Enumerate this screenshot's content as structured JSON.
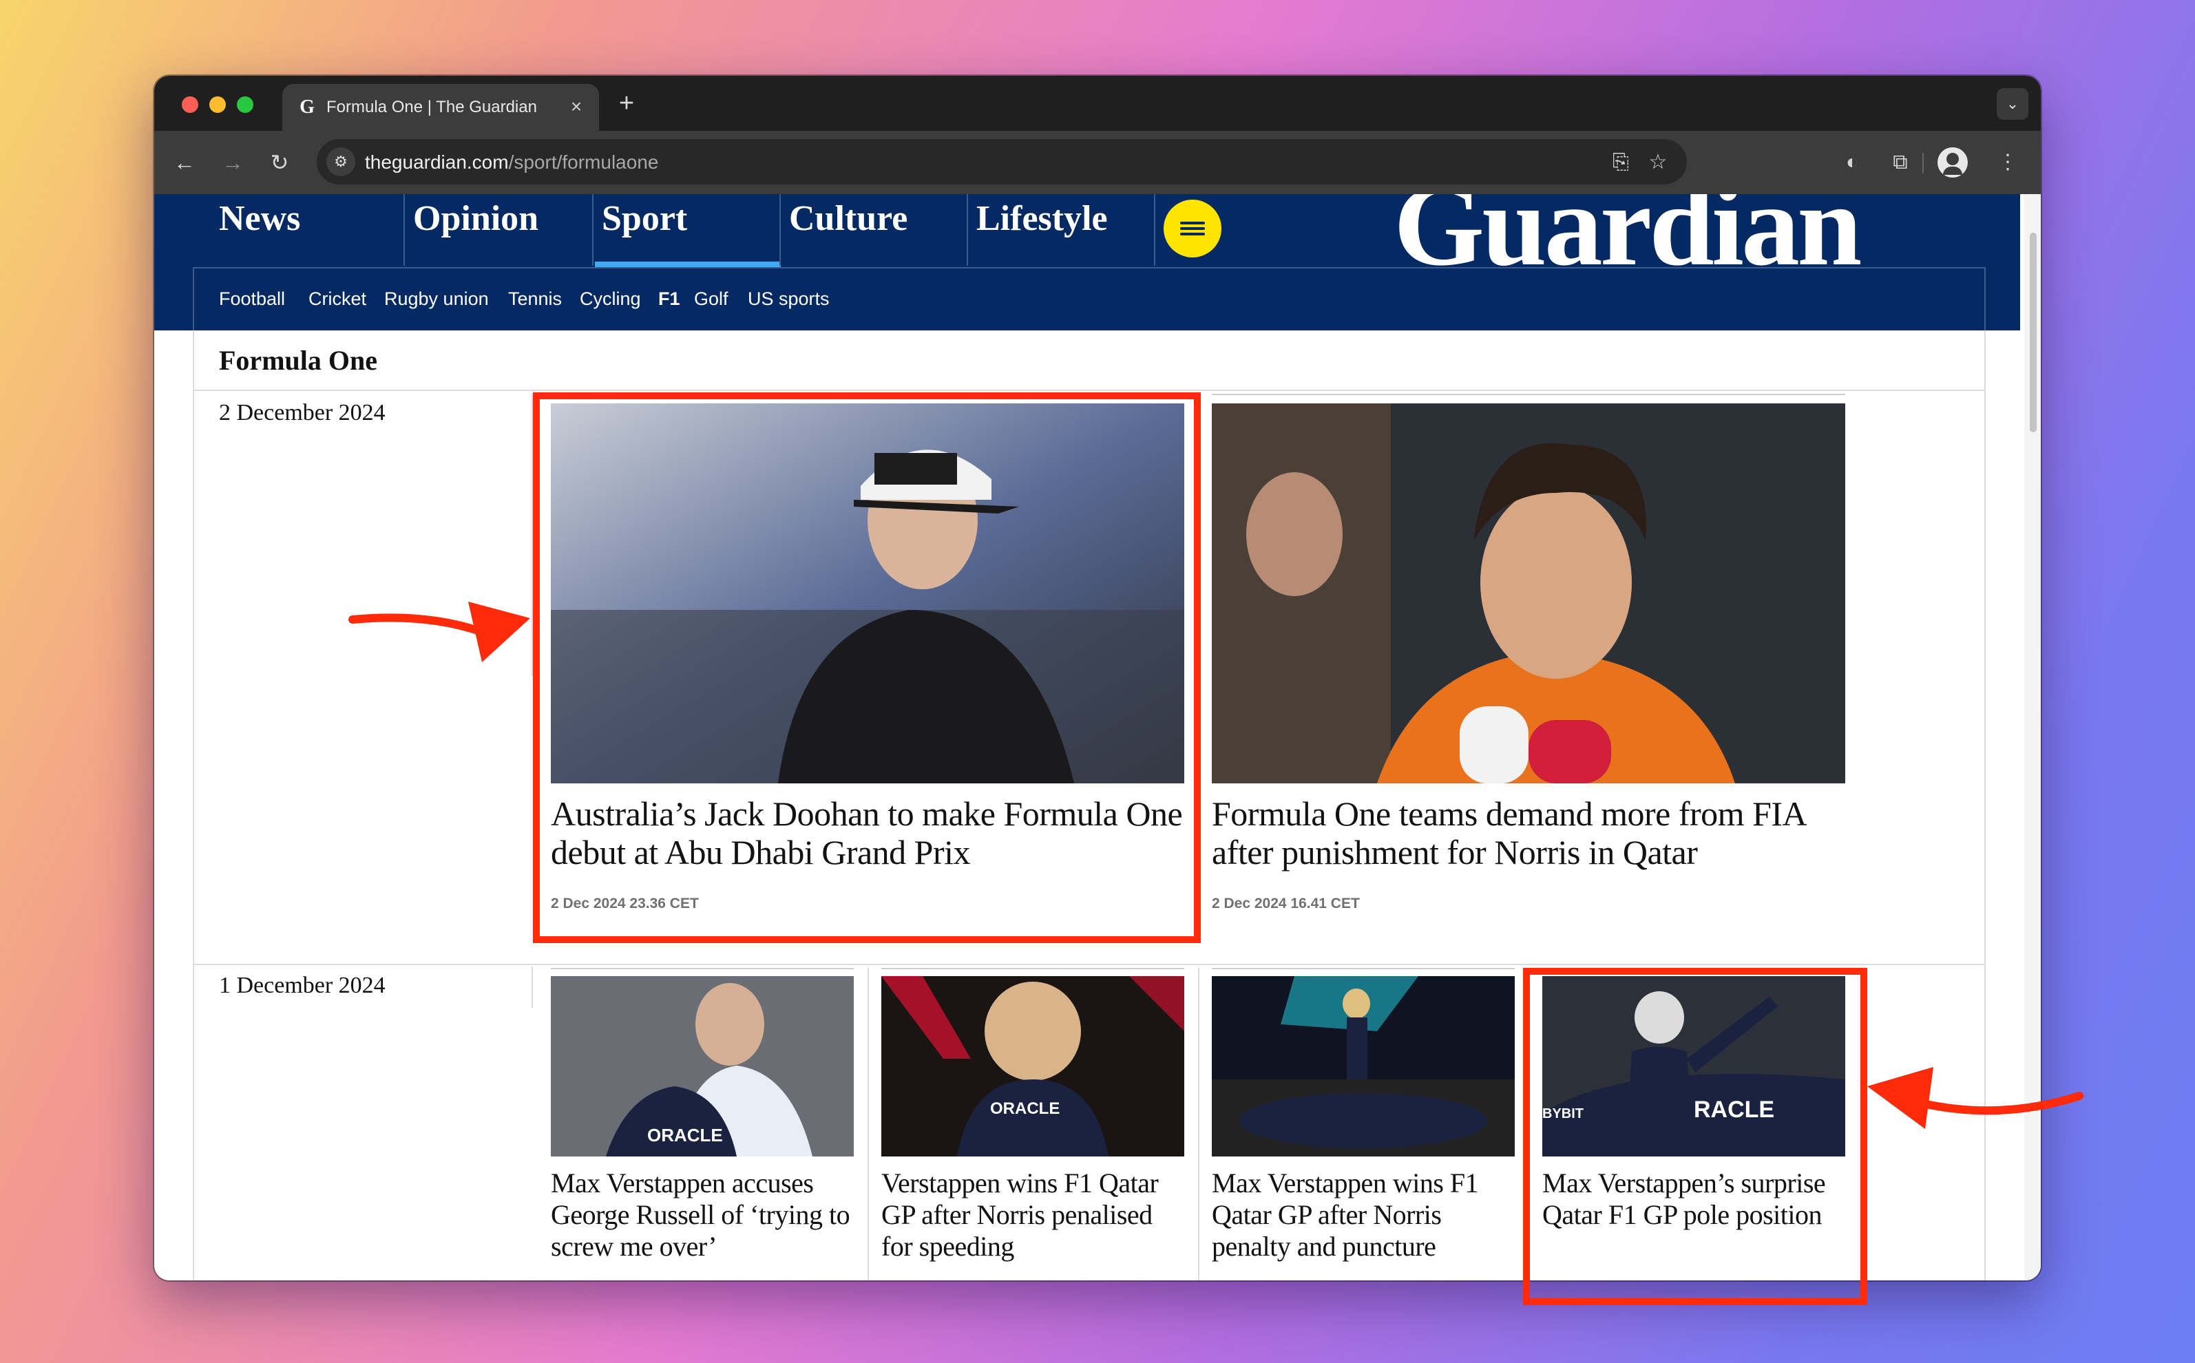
{
  "browser": {
    "tab_title": "Formula One | The Guardian",
    "tab_favicon": "G",
    "url_domain": "theguardian.com",
    "url_path": "/sport/formulaone"
  },
  "nav": {
    "pillars": [
      "News",
      "Opinion",
      "Sport",
      "Culture",
      "Lifestyle"
    ],
    "active_pillar": "Sport",
    "logo": "Guardian",
    "subnav": [
      "Football",
      "Cricket",
      "Rugby union",
      "Tennis",
      "Cycling",
      "F1",
      "Golf",
      "US sports"
    ],
    "active_subnav": "F1"
  },
  "section": {
    "title": "Formula One"
  },
  "days": [
    {
      "date": "2 December 2024",
      "articles": [
        {
          "headline": "Australia’s Jack Doohan to make Formula One debut at Abu Dhabi Grand Prix",
          "timestamp": "2 Dec 2024 23.36 CET",
          "image_icon": "driver-portrait-image",
          "highlighted": true
        },
        {
          "headline": "Formula One teams demand more from FIA after punishment for Norris in Qatar",
          "timestamp": "2 Dec 2024 16.41 CET",
          "image_icon": "driver-interview-image",
          "highlighted": false
        }
      ]
    },
    {
      "date": "1 December 2024",
      "articles": [
        {
          "headline": "Max Verstappen accuses George Russell of ‘trying to screw me over’",
          "image_icon": "drivers-podium-image"
        },
        {
          "headline": "Verstappen wins F1 Qatar GP after Norris penalised for speeding",
          "image_icon": "helmet-closeup-image"
        },
        {
          "headline": "Max Verstappen wins F1 Qatar GP after Norris penalty and puncture",
          "image_icon": "car-celebration-image"
        },
        {
          "headline": "Max Verstappen’s surprise Qatar F1 GP pole position",
          "image_icon": "driver-waving-image",
          "highlighted": true
        }
      ]
    }
  ],
  "colors": {
    "masthead": "#052962",
    "menu_button": "#ffe500",
    "active_underline": "#3fa9f5",
    "annotation": "#ff2a0a"
  }
}
